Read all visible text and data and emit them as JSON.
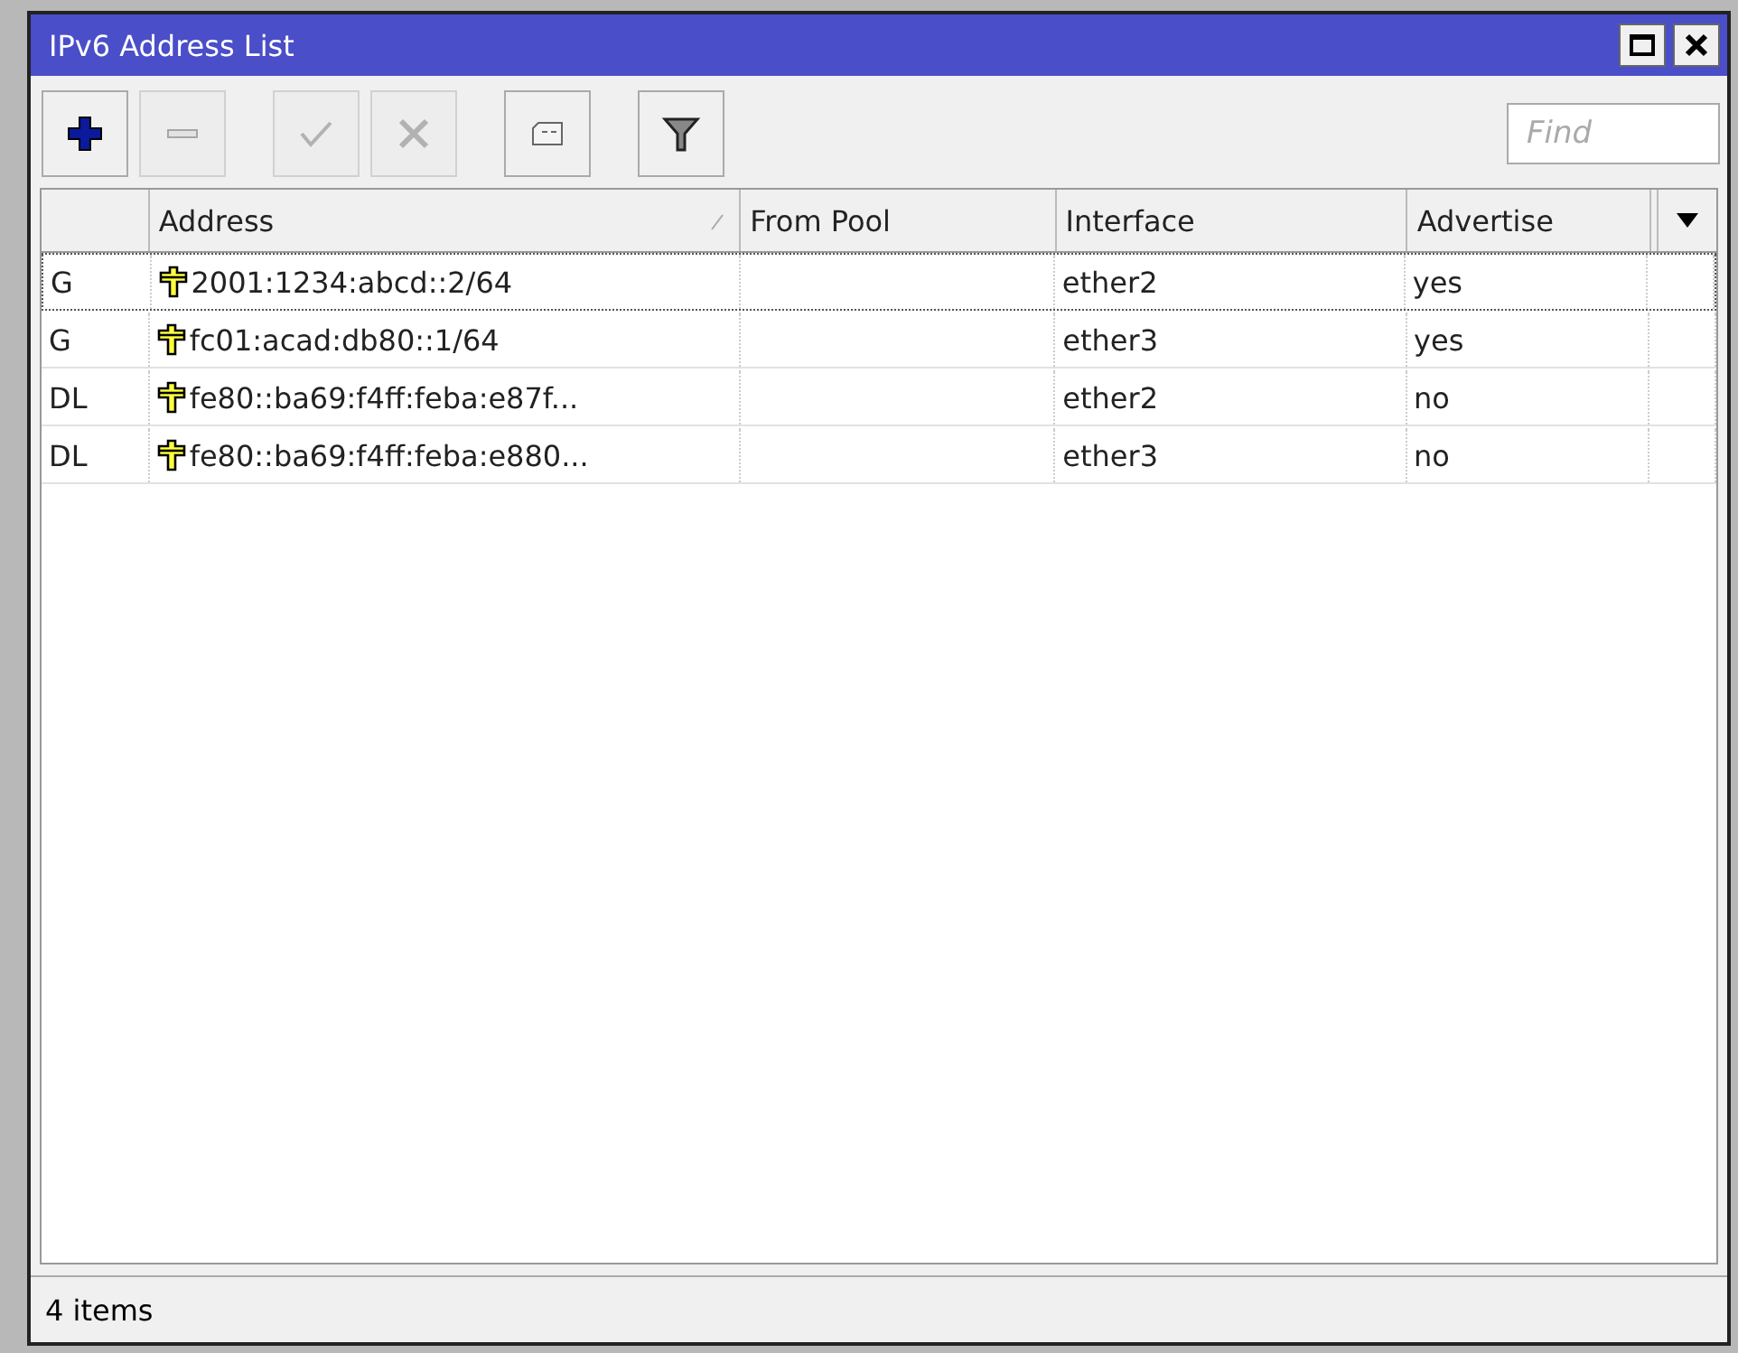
{
  "window": {
    "title": "IPv6 Address List"
  },
  "toolbar": [
    {
      "kind": "add",
      "disabled": false
    },
    {
      "kind": "remove",
      "disabled": true
    },
    {
      "kind": "enable",
      "disabled": true
    },
    {
      "kind": "disable",
      "disabled": true
    },
    {
      "kind": "comment",
      "disabled": false
    },
    {
      "kind": "filter",
      "disabled": false
    }
  ],
  "search": {
    "placeholder": "Find"
  },
  "table": {
    "columns": [
      {},
      {
        "label": "Address",
        "sorted": true
      },
      {
        "label": "From Pool",
        "sorted": false
      },
      {
        "label": "Interface",
        "sorted": false
      },
      {
        "label": "Advertise",
        "sorted": false
      }
    ],
    "rows": [
      {
        "flags": "G",
        "address": "2001:1234:abcd::2/64",
        "interface": "ether2",
        "advertise": "yes",
        "selected": true
      },
      {
        "flags": "G",
        "address": "fc01:acad:db80::1/64",
        "interface": "ether3",
        "advertise": "yes",
        "selected": false
      },
      {
        "flags": "DL",
        "address": "fe80::ba69:f4ff:feba:e87f...",
        "interface": "ether2",
        "advertise": "no",
        "selected": false
      },
      {
        "flags": "DL",
        "address": "fe80::ba69:f4ff:feba:e880...",
        "interface": "ether3",
        "advertise": "no",
        "selected": false
      }
    ]
  },
  "status_bar": "4 items"
}
